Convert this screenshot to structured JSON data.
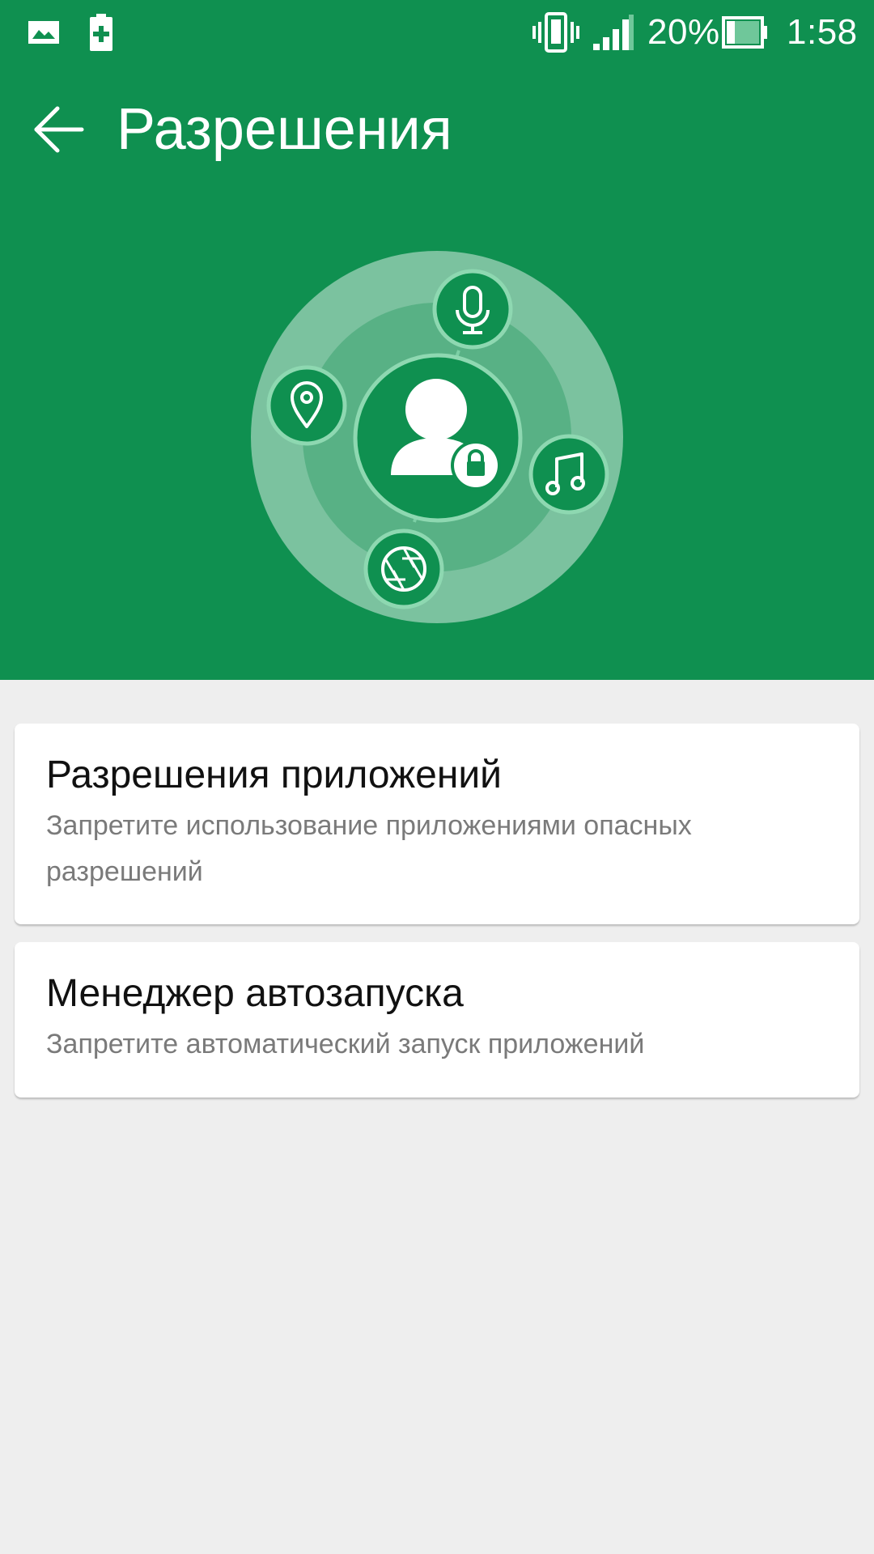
{
  "status_bar": {
    "battery_percent": "20%",
    "time": "1:58",
    "icons": [
      "gallery-icon",
      "battery-saver-icon",
      "vibrate-icon",
      "signal-icon",
      "battery-icon"
    ]
  },
  "toolbar": {
    "title": "Разрешения",
    "back_icon": "arrow-left-icon"
  },
  "illustration": {
    "center_icon": "user-lock-icon",
    "orbit_icons": [
      "microphone-icon",
      "location-pin-icon",
      "music-note-icon",
      "camera-aperture-icon"
    ]
  },
  "cards": [
    {
      "title": "Разрешения приложений",
      "subtitle": "Запретите использование приложениями опасных разрешений"
    },
    {
      "title": "Менеджер автозапуска",
      "subtitle": "Запретите автоматический запуск приложений"
    }
  ],
  "colors": {
    "header_green": "#0f9050",
    "background": "#eeeeee",
    "card": "#ffffff"
  }
}
